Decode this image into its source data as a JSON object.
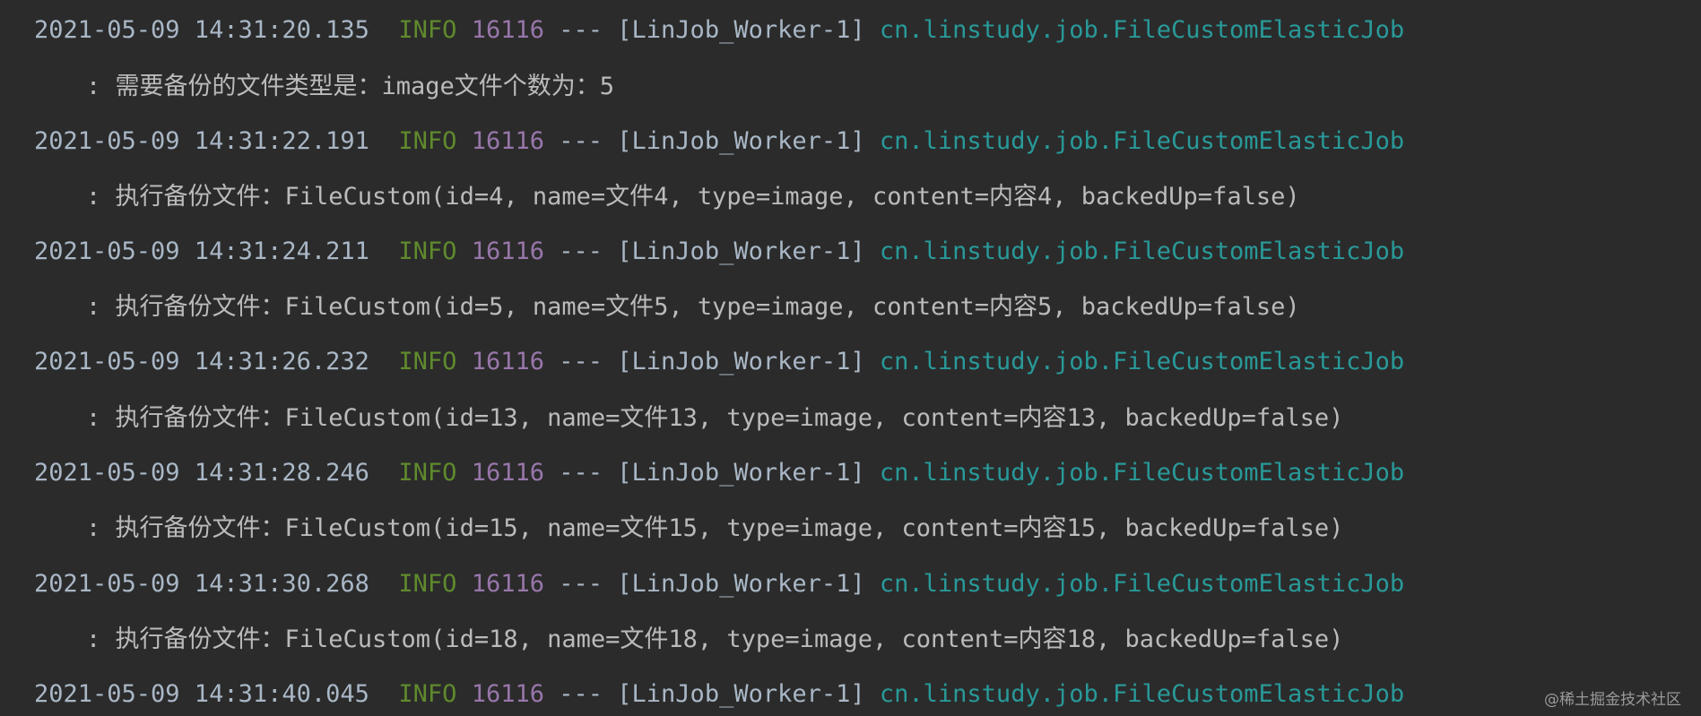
{
  "console": {
    "entries": [
      {
        "timestamp": "2021-05-09 14:31:20.135",
        "level": "INFO",
        "pid": "16116",
        "separator": "---",
        "thread": "[LinJob_Worker-1]",
        "logger": "cn.linstudy.job.FileCustomElasticJob",
        "message": ": 需要备份的文件类型是：image文件个数为：5"
      },
      {
        "timestamp": "2021-05-09 14:31:22.191",
        "level": "INFO",
        "pid": "16116",
        "separator": "---",
        "thread": "[LinJob_Worker-1]",
        "logger": "cn.linstudy.job.FileCustomElasticJob",
        "message": ": 执行备份文件：FileCustom(id=4, name=文件4, type=image, content=内容4, backedUp=false)"
      },
      {
        "timestamp": "2021-05-09 14:31:24.211",
        "level": "INFO",
        "pid": "16116",
        "separator": "---",
        "thread": "[LinJob_Worker-1]",
        "logger": "cn.linstudy.job.FileCustomElasticJob",
        "message": ": 执行备份文件：FileCustom(id=5, name=文件5, type=image, content=内容5, backedUp=false)"
      },
      {
        "timestamp": "2021-05-09 14:31:26.232",
        "level": "INFO",
        "pid": "16116",
        "separator": "---",
        "thread": "[LinJob_Worker-1]",
        "logger": "cn.linstudy.job.FileCustomElasticJob",
        "message": ": 执行备份文件：FileCustom(id=13, name=文件13, type=image, content=内容13, backedUp=false)"
      },
      {
        "timestamp": "2021-05-09 14:31:28.246",
        "level": "INFO",
        "pid": "16116",
        "separator": "---",
        "thread": "[LinJob_Worker-1]",
        "logger": "cn.linstudy.job.FileCustomElasticJob",
        "message": ": 执行备份文件：FileCustom(id=15, name=文件15, type=image, content=内容15, backedUp=false)"
      },
      {
        "timestamp": "2021-05-09 14:31:30.268",
        "level": "INFO",
        "pid": "16116",
        "separator": "---",
        "thread": "[LinJob_Worker-1]",
        "logger": "cn.linstudy.job.FileCustomElasticJob",
        "message": ": 执行备份文件：FileCustom(id=18, name=文件18, type=image, content=内容18, backedUp=false)"
      },
      {
        "timestamp": "2021-05-09 14:31:40.045",
        "level": "INFO",
        "pid": "16116",
        "separator": "---",
        "thread": "[LinJob_Worker-1]",
        "logger": "cn.linstudy.job.FileCustomElasticJob"
      }
    ]
  },
  "watermark": "@稀土掘金技术社区",
  "colors": {
    "background": "#2b2b2b",
    "text": "#a9b7c6",
    "level_info": "#5f8a2d",
    "pid": "#9876aa",
    "logger": "#299999"
  }
}
